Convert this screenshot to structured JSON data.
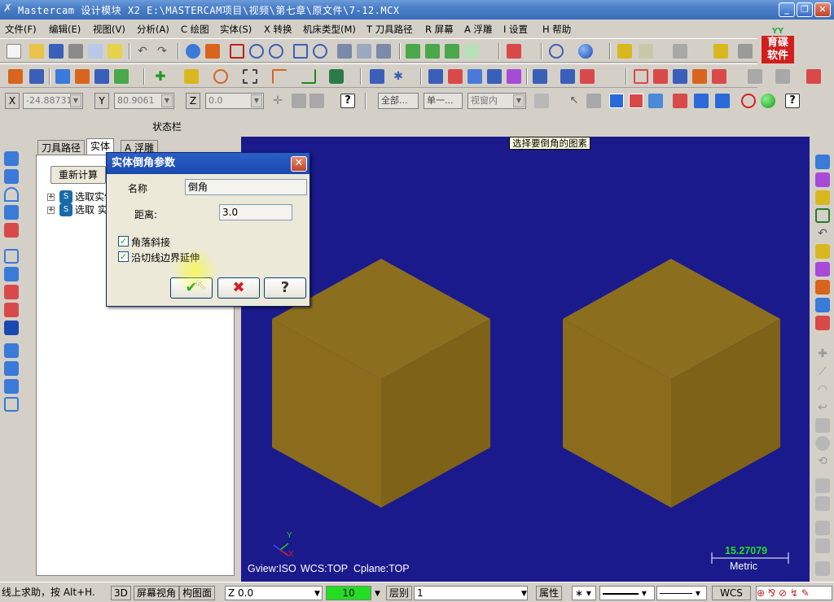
{
  "window": {
    "title": "Mastercam 设计模块  X2  E:\\MASTERCAM项目\\视频\\第七章\\原文件\\7-12.MCX",
    "min_label": "_",
    "max_label": "❐",
    "close_label": "✕"
  },
  "menu": [
    "文件(F)",
    "编辑(E)",
    "视图(V)",
    "分析(A)",
    "C 绘图",
    "实体(S)",
    "X 转换",
    "机床类型(M)",
    "T 刀具路径",
    "R 屏幕",
    "A 浮雕",
    "I 设置",
    "H 帮助"
  ],
  "brand": {
    "line1": "育碟",
    "line2": "软件"
  },
  "coordbar": {
    "x_label": "X",
    "x_value": "-24.88731",
    "y_label": "Y",
    "y_value": "80.9061",
    "z_label": "Z",
    "z_value": "0.0",
    "all_label": "全部...",
    "single_label": "单一...",
    "selmode_value": "视窗内"
  },
  "statusbar_label": "状态栏",
  "left_panel": {
    "tabs": [
      "刀具路径",
      "实体",
      "A 浮雕"
    ],
    "active_tab": 1,
    "recalc_label": "重新计算",
    "tree_items": [
      "选取实体",
      "选取 实体"
    ]
  },
  "viewport": {
    "prompt": "选择要倒角的图素",
    "gview": "Gview:ISO",
    "wcs": "WCS:TOP",
    "cplane": "Cplane:TOP",
    "scale_value": "15.27079",
    "scale_unit": "Metric",
    "axis_y": "Y",
    "axis_x": "X",
    "background_color": "#1a1a8c",
    "solid_color": "#8c6f1e"
  },
  "dialog": {
    "title": "实体倒角参数",
    "name_label": "名称",
    "name_value": "倒角",
    "distance_label": "距离:",
    "distance_value": "3.0",
    "check1_label": "角落斜接",
    "check1_checked": true,
    "check2_label": "沿切线边界延伸",
    "check2_checked": true,
    "ok_symbol": "✔",
    "cancel_symbol": "✖",
    "help_symbol": "?"
  },
  "bottombar": {
    "help_text": "线上求助，按 Alt+H.",
    "view_3d": "3D",
    "screen_view": "屏幕视角",
    "construct_plane": "构图面",
    "z_value": "Z 0.0",
    "color_value": "10",
    "level_label": "层别",
    "level_value": "1",
    "attr_label": "属性",
    "wcs_label": "WCS"
  }
}
